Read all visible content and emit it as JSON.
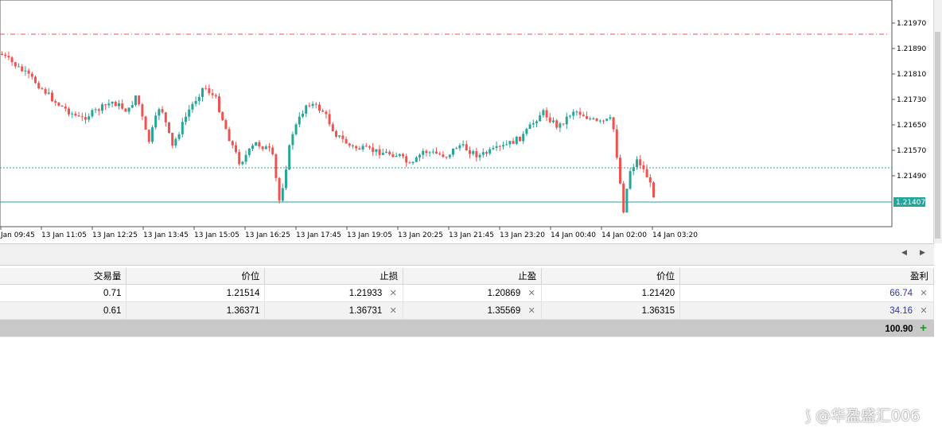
{
  "chart": {
    "price_axis": [
      "1.21970",
      "1.21890",
      "1.21810",
      "1.21730",
      "1.21650",
      "1.21570",
      "1.21490"
    ],
    "current_price": "1.21407",
    "time_axis": [
      "Jan 09:45",
      "13 Jan 11:05",
      "13 Jan 12:25",
      "13 Jan 13:45",
      "13 Jan 15:05",
      "13 Jan 16:25",
      "13 Jan 17:45",
      "13 Jan 19:05",
      "13 Jan 20:25",
      "13 Jan 21:45",
      "13 Jan 23:20",
      "14 Jan 00:40",
      "14 Jan 02:00",
      "14 Jan 03:20"
    ],
    "colors": {
      "bull": "#26a69a",
      "bear": "#ef5350",
      "stop_loss_line": "#e05555",
      "entry_line": "#26a69a",
      "price_tag": "#26a69a"
    }
  },
  "table": {
    "headers": [
      "交易量",
      "价位",
      "止损",
      "止盈",
      "价位",
      "盈利"
    ],
    "rows": [
      {
        "volume": "0.71",
        "open_price": "1.21514",
        "stop_loss": "1.21933",
        "take_profit": "1.20869",
        "price": "1.21420",
        "profit": "66.74"
      },
      {
        "volume": "0.61",
        "open_price": "1.36371",
        "stop_loss": "1.36731",
        "take_profit": "1.35569",
        "price": "1.36315",
        "profit": "34.16"
      }
    ],
    "total_profit": "100.90"
  },
  "icons": {
    "close": "close-icon",
    "add": "plus-icon",
    "scroll_left": "chevron-left-icon",
    "scroll_right": "chevron-right-icon"
  },
  "watermark": {
    "text": "@华盈盛汇006"
  }
}
